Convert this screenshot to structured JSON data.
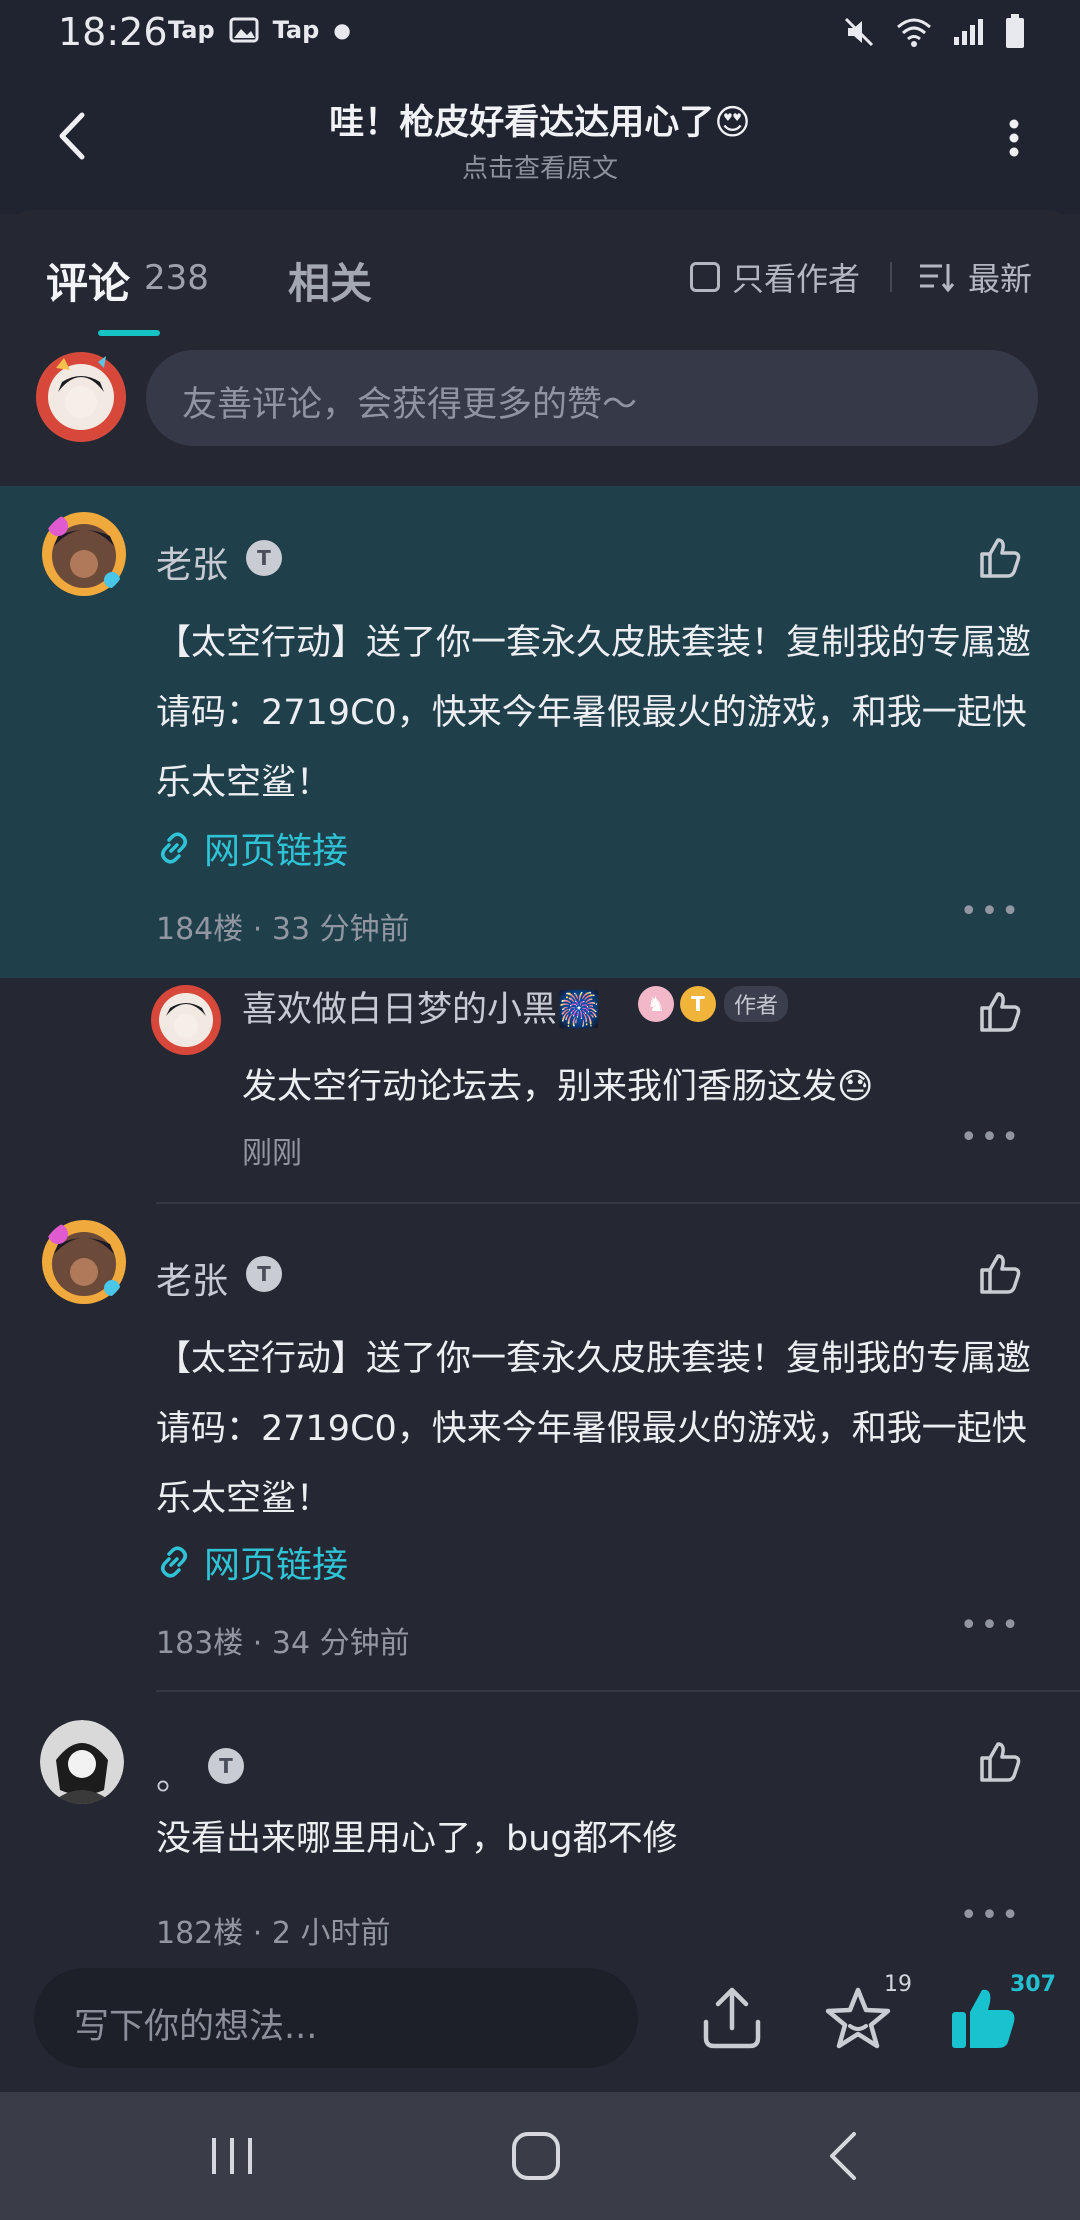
{
  "status_bar": {
    "time": "18:26",
    "app1": "Tap",
    "app2": "Tap"
  },
  "header": {
    "title": "哇！枪皮好看达达用心了😍",
    "subtitle": "点击查看原文"
  },
  "tabs": {
    "comments_label": "评论",
    "comments_count": "238",
    "related_label": "相关",
    "author_only_label": "只看作者",
    "sort_label": "最新"
  },
  "comment_input": {
    "placeholder": "友善评论，会获得更多的赞～"
  },
  "comments": [
    {
      "username": "老张",
      "badge": "T",
      "content": "【太空行动】送了你一套永久皮肤套装！复制我的专属邀请码：2719C0，快来今年暑假最火的游戏，和我一起快乐太空鲨！",
      "link_label": "网页链接",
      "meta": "184楼 · 33 分钟前",
      "reply": {
        "username": "喜欢做白日梦的小黑🎆",
        "author_tag": "作者",
        "content": "发太空行动论坛去，别来我们香肠这发😓",
        "time": "刚刚"
      }
    },
    {
      "username": "老张",
      "badge": "T",
      "content": "【太空行动】送了你一套永久皮肤套装！复制我的专属邀请码：2719C0，快来今年暑假最火的游戏，和我一起快乐太空鲨！",
      "link_label": "网页链接",
      "meta": "183楼 · 34 分钟前"
    },
    {
      "username": "。",
      "badge": "T",
      "content": "没看出来哪里用心了，bug都不修",
      "meta": "182楼 · 2 小时前"
    }
  ],
  "bottom_bar": {
    "input_placeholder": "写下你的想法...",
    "favorite_count": "19",
    "like_count": "307"
  },
  "colors": {
    "accent": "#16c2c4",
    "link": "#2fc3d6",
    "highlight_bg": "#1f3f4a",
    "background": "#252833"
  },
  "icons": [
    "back-icon",
    "more-icon",
    "sort-icon",
    "like-icon",
    "link-icon",
    "share-icon",
    "star-icon",
    "thumbs-up-filled-icon",
    "recents-icon",
    "home-icon",
    "nav-back-icon"
  ]
}
